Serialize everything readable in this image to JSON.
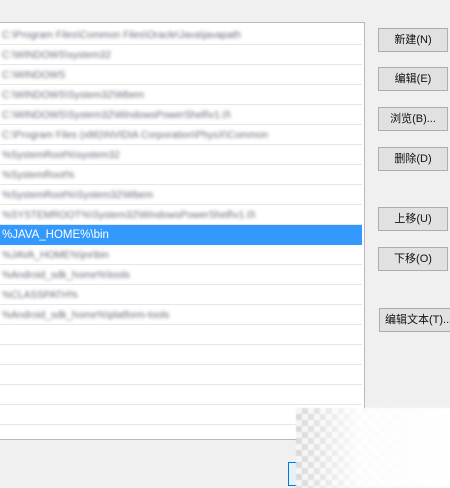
{
  "path_list": {
    "rows": [
      {
        "text": "C:\\Program Files\\Common Files\\Oracle\\Java\\javapath",
        "state": "blurred"
      },
      {
        "text": "C:\\WINDOWS\\system32",
        "state": "blurred"
      },
      {
        "text": "C:\\WINDOWS",
        "state": "blurred"
      },
      {
        "text": "C:\\WINDOWS\\System32\\Wbem",
        "state": "blurred"
      },
      {
        "text": "C:\\WINDOWS\\System32\\WindowsPowerShell\\v1.0\\",
        "state": "blurred"
      },
      {
        "text": "C:\\Program Files (x86)\\NVIDIA Corporation\\PhysX\\Common",
        "state": "blurred"
      },
      {
        "text": "%SystemRoot%\\system32",
        "state": "blurred"
      },
      {
        "text": "%SystemRoot%",
        "state": "blurred"
      },
      {
        "text": "%SystemRoot%\\System32\\Wbem",
        "state": "blurred"
      },
      {
        "text": "%SYSTEMROOT%\\System32\\WindowsPowerShell\\v1.0\\",
        "state": "blurred"
      },
      {
        "text": "%JAVA_HOME%\\bin",
        "state": "selected"
      },
      {
        "text": "%JAVA_HOME%\\jre\\bin",
        "state": "blurred"
      },
      {
        "text": "%Android_sdk_home%\\tools",
        "state": "blurred"
      },
      {
        "text": "%CLASSPATH%",
        "state": "blurred"
      },
      {
        "text": "%Android_sdk_home%\\platform-tools",
        "state": "blurred"
      },
      {
        "text": "",
        "state": "empty"
      },
      {
        "text": "",
        "state": "empty"
      },
      {
        "text": "",
        "state": "empty"
      },
      {
        "text": "",
        "state": "empty"
      },
      {
        "text": "",
        "state": "empty"
      }
    ]
  },
  "buttons": {
    "new": "新建(N)",
    "edit": "编辑(E)",
    "browse": "浏览(B)...",
    "delete": "删除(D)",
    "move_up": "上移(U)",
    "move_down": "下移(O)",
    "edit_text": "编辑文本(T)..."
  },
  "colors": {
    "selection": "#3399ff",
    "background": "#f0f0f0"
  }
}
